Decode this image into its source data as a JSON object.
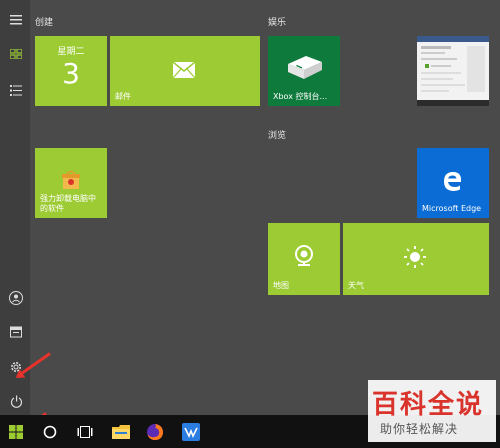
{
  "groups": {
    "create": "创建",
    "entertainment": "娱乐",
    "browse": "浏览"
  },
  "tiles": {
    "calendar": {
      "weekday": "星期二",
      "day": "3"
    },
    "mail": {
      "label": "邮件"
    },
    "xbox": {
      "label": "Xbox 控制台..."
    },
    "uninstall": {
      "label": "强力卸载电脑中\n的软件"
    },
    "edge": {
      "label": "Microsoft Edge"
    },
    "maps": {
      "label": "地图"
    },
    "weather": {
      "label": "天气"
    }
  },
  "watermark": {
    "title": "百科全说",
    "subtitle": "助你轻松解决"
  },
  "colors": {
    "tile_green": "#9ccb34",
    "xbox_green": "#0e7a3c",
    "edge_blue": "#0a6cd4",
    "arrow_red": "#e8322c"
  }
}
